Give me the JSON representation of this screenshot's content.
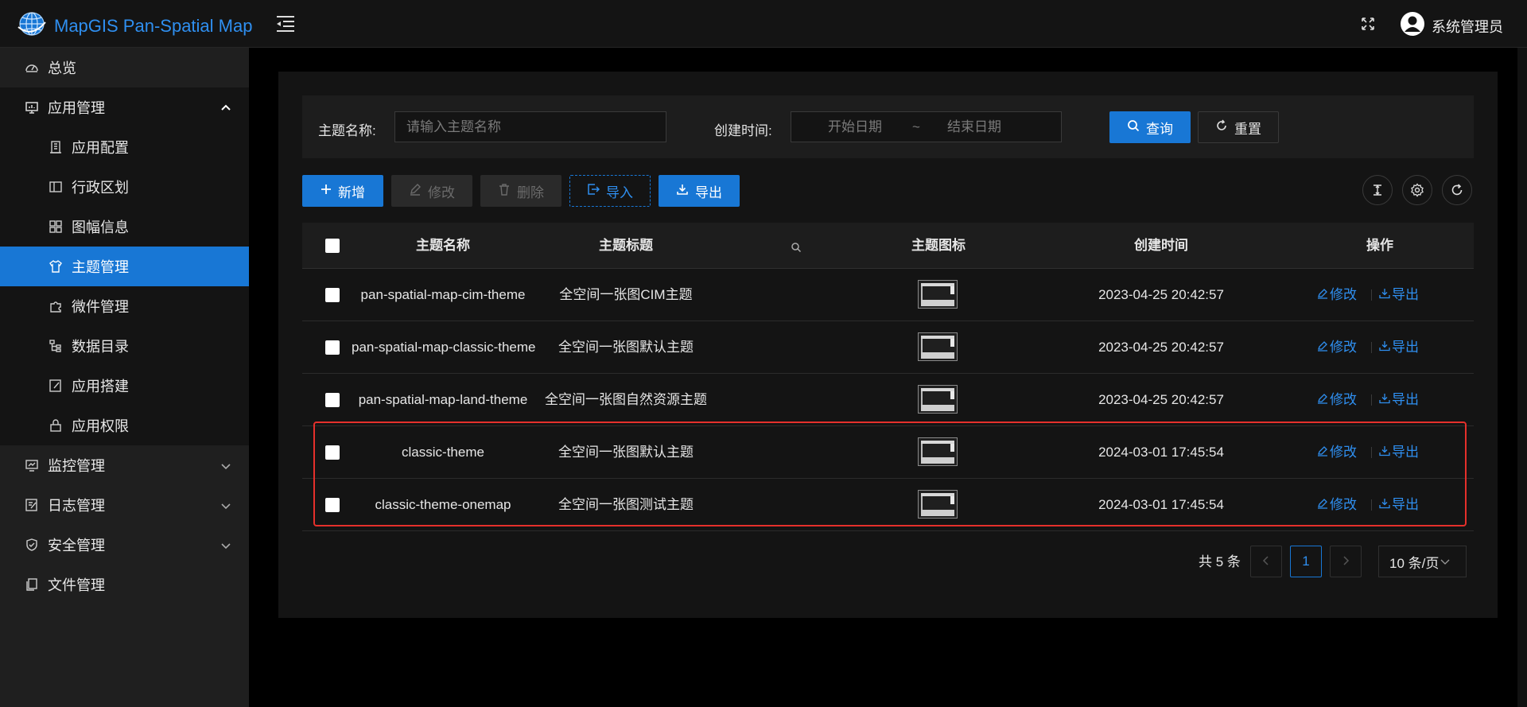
{
  "app": {
    "title": "MapGIS Pan-Spatial Map",
    "user": "系统管理员"
  },
  "colors": {
    "accent": "#1877d5",
    "link": "#2f8ff0",
    "highlight": "#e5302b",
    "background": "#000000",
    "panel": "#141414"
  },
  "sidebar": {
    "items": [
      {
        "label": "总览",
        "icon": "dashboard-icon",
        "level": "top"
      },
      {
        "label": "应用管理",
        "icon": "monitor-icon",
        "level": "top",
        "expanded": true
      },
      {
        "label": "应用配置",
        "icon": "building-icon",
        "level": "sub"
      },
      {
        "label": "行政区划",
        "icon": "layout-icon",
        "level": "sub"
      },
      {
        "label": "图幅信息",
        "icon": "grid-icon",
        "level": "sub"
      },
      {
        "label": "主题管理",
        "icon": "shirt-icon",
        "level": "sub",
        "active": true
      },
      {
        "label": "微件管理",
        "icon": "puzzle-icon",
        "level": "sub"
      },
      {
        "label": "数据目录",
        "icon": "tree-icon",
        "level": "sub"
      },
      {
        "label": "应用搭建",
        "icon": "edit-icon",
        "level": "sub"
      },
      {
        "label": "应用权限",
        "icon": "lock-icon",
        "level": "sub"
      },
      {
        "label": "监控管理",
        "icon": "fund-icon",
        "level": "top",
        "expanded": false
      },
      {
        "label": "日志管理",
        "icon": "form-icon",
        "level": "top",
        "expanded": false
      },
      {
        "label": "安全管理",
        "icon": "shield-icon",
        "level": "top",
        "expanded": false
      },
      {
        "label": "文件管理",
        "icon": "file-icon",
        "level": "top"
      }
    ]
  },
  "search": {
    "name_label": "主题名称:",
    "name_placeholder": "请输入主题名称",
    "time_label": "创建时间:",
    "start_placeholder": "开始日期",
    "range_sep": "~",
    "end_placeholder": "结束日期",
    "query": "查询",
    "reset": "重置"
  },
  "toolbar": {
    "add": "新增",
    "edit": "修改",
    "delete": "删除",
    "import": "导入",
    "export": "导出"
  },
  "table": {
    "columns": [
      "主题名称",
      "主题标题",
      "主题图标",
      "创建时间",
      "操作"
    ],
    "rows": [
      {
        "name": "pan-spatial-map-cim-theme",
        "title": "全空间一张图CIM主题",
        "created": "2023-04-25 20:42:57"
      },
      {
        "name": "pan-spatial-map-classic-theme",
        "title": "全空间一张图默认主题",
        "created": "2023-04-25 20:42:57"
      },
      {
        "name": "pan-spatial-map-land-theme",
        "title": "全空间一张图自然资源主题",
        "created": "2023-04-25 20:42:57"
      },
      {
        "name": "classic-theme",
        "title": "全空间一张图默认主题",
        "created": "2024-03-01 17:45:54"
      },
      {
        "name": "classic-theme-onemap",
        "title": "全空间一张图测试主题",
        "created": "2024-03-01 17:45:54"
      }
    ],
    "row_actions": {
      "edit": "修改",
      "export": "导出"
    }
  },
  "pagination": {
    "total": "共 5 条",
    "current": "1",
    "page_size": "10 条/页"
  }
}
